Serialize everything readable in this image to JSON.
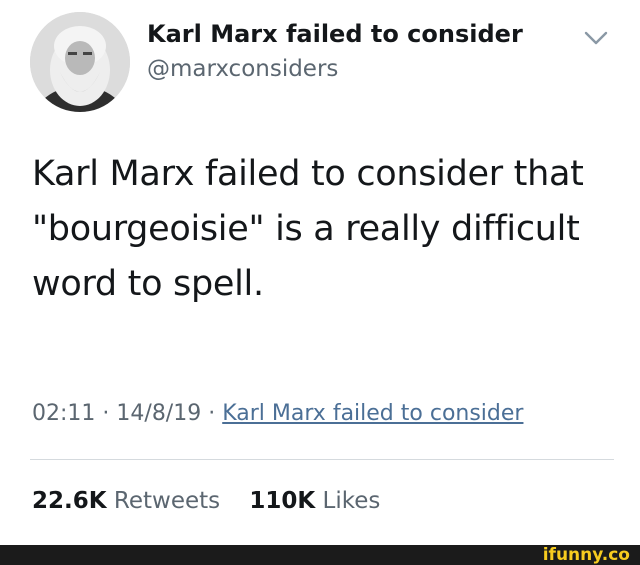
{
  "tweet": {
    "display_name": "Karl Marx failed to consider",
    "handle": "@marxconsiders",
    "text": "Karl Marx failed to consider that \"bourgeoisie\" is a really difficult word to spell.",
    "time": "02:11",
    "date": "14/8/19",
    "separator": "·",
    "source": "Karl Marx failed to consider",
    "retweets_count": "22.6K",
    "retweets_label": "Retweets",
    "likes_count": "110K",
    "likes_label": "Likes",
    "menu_icon": "chevron-down-icon",
    "avatar_icon": "avatar-portrait"
  },
  "watermark": {
    "text": "ifunny.co",
    "color": "#f7cc1f"
  }
}
